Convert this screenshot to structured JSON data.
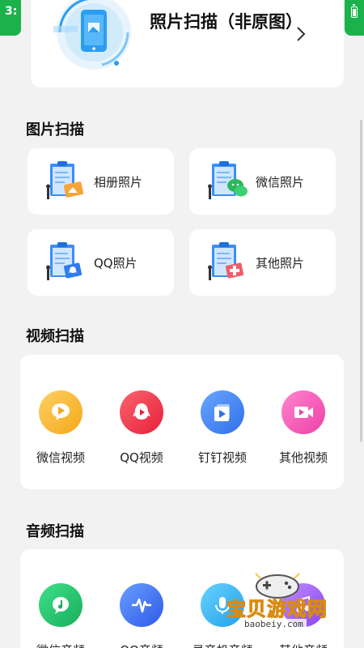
{
  "status": {
    "time_fragment": "3:",
    "battery_icon": "battery-charging-icon"
  },
  "top_card": {
    "title": "照片扫描（非原图）",
    "arrow_icon": "chevron-right-icon"
  },
  "sections": {
    "photos": {
      "title": "图片扫描",
      "items": [
        {
          "label": "相册照片",
          "icon": "album-clipboard-icon"
        },
        {
          "label": "微信照片",
          "icon": "wechat-clipboard-icon"
        },
        {
          "label": "QQ照片",
          "icon": "qq-clipboard-icon"
        },
        {
          "label": "其他照片",
          "icon": "other-clipboard-icon"
        }
      ]
    },
    "videos": {
      "title": "视频扫描",
      "items": [
        {
          "label": "微信视频",
          "icon": "wechat-video-icon",
          "color": "#f9b82d"
        },
        {
          "label": "QQ视频",
          "icon": "qq-video-icon",
          "color": "#f0384a"
        },
        {
          "label": "钉钉视频",
          "icon": "dingtalk-video-icon",
          "color": "#3a82f2"
        },
        {
          "label": "其他视频",
          "icon": "other-video-icon",
          "color": "#f25bb5"
        }
      ]
    },
    "audio": {
      "title": "音频扫描",
      "items": [
        {
          "label": "微信音频",
          "icon": "wechat-audio-icon",
          "color": "#25c26e"
        },
        {
          "label": "QQ音频",
          "icon": "qq-audio-icon",
          "color": "#3a6ef2"
        },
        {
          "label": "录音机音频",
          "icon": "recorder-audio-icon",
          "color": "#39b5f2"
        },
        {
          "label": "其他音频",
          "icon": "other-audio-icon",
          "color": "#9b5df2"
        }
      ]
    }
  },
  "watermark": {
    "text": "宝贝游戏网",
    "url": "baobeiy.com"
  }
}
